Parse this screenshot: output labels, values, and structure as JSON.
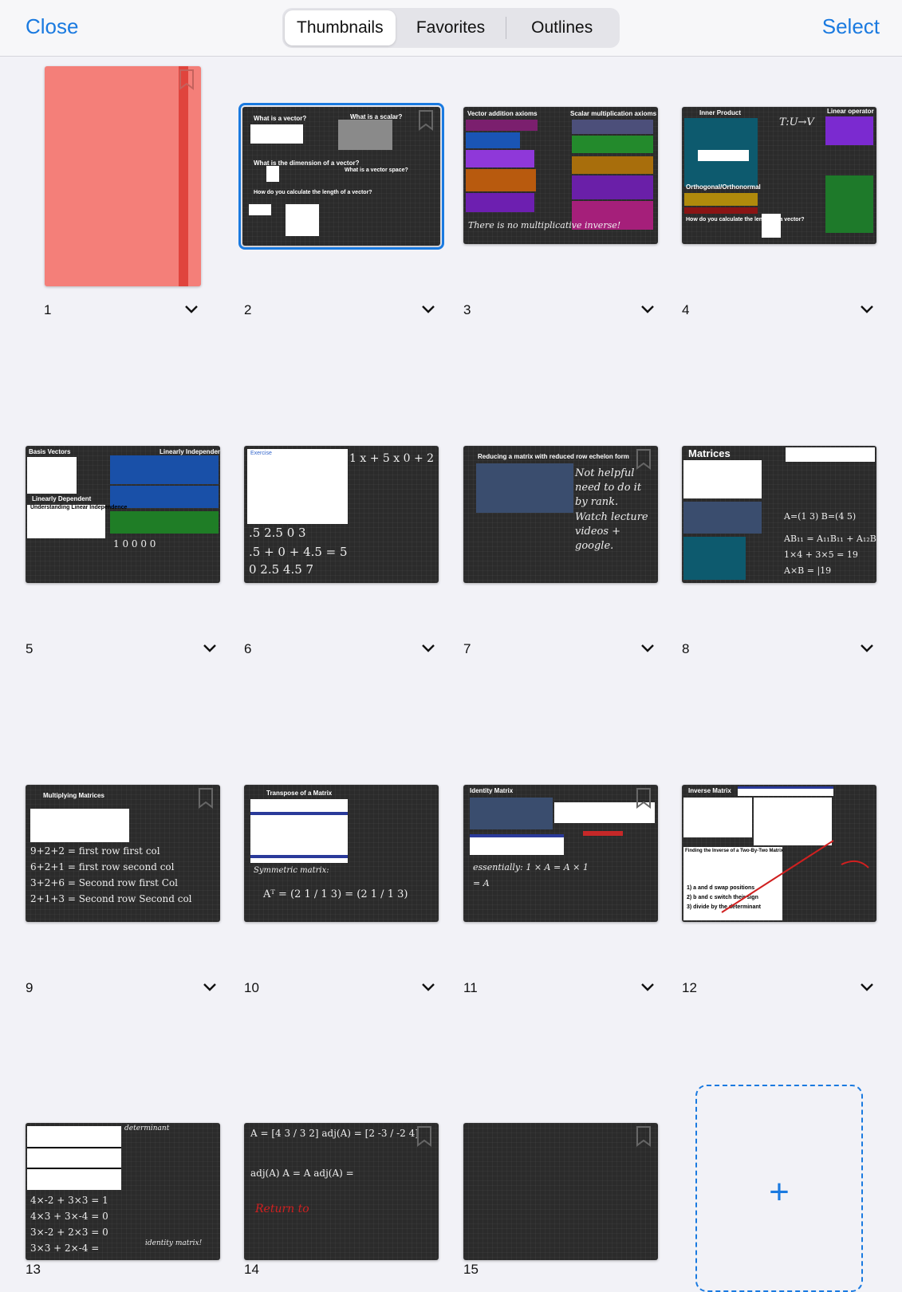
{
  "toolbar": {
    "close_label": "Close",
    "select_label": "Select",
    "tabs": [
      "Thumbnails",
      "Favorites",
      "Outlines"
    ],
    "active_tab": "Thumbnails"
  },
  "pages": [
    {
      "number": "1"
    },
    {
      "number": "2",
      "title_a": "What is a vector?",
      "title_b": "What is a scalar?",
      "title_c": "What is the dimension of a vector?",
      "title_d": "How do you calculate the length of a vector?",
      "title_e": "What is a vector space?"
    },
    {
      "number": "3",
      "title_a": "Vector addition axioms",
      "title_b": "Scalar multiplication axioms",
      "note": "There is no multiplicative inverse!"
    },
    {
      "number": "4",
      "title_a": "Inner Product",
      "title_b": "Linear operator",
      "title_c": "Orthogonal/Orthonormal",
      "title_d": "How do you calculate the length of a vector?",
      "note": "T:U→V"
    },
    {
      "number": "5",
      "title_a": "Basis Vectors",
      "title_b": "Linearly Independent",
      "title_c": "Linearly Dependent",
      "title_d": "Understanding Linear Independence"
    },
    {
      "number": "6",
      "title_a": "Exercise"
    },
    {
      "number": "7",
      "title_a": "Reducing a matrix with reduced row echelon form",
      "note": "Not helpful need to do it by rank. Watch lecture videos + google."
    },
    {
      "number": "8",
      "title_a": "Matrices",
      "note": "A=(1 3) B=(4 5)"
    },
    {
      "number": "9",
      "title_a": "Multiplying Matrices",
      "lines": [
        "9+2+2 = first row first col",
        "6+2+1 = first row second col",
        "3+2+6 = Second row first Col",
        "2+1+3 = Second row Second col"
      ]
    },
    {
      "number": "10",
      "title_a": "Transpose of a Matrix",
      "note": "Symmetric matrix:"
    },
    {
      "number": "11",
      "title_a": "Identity Matrix",
      "note": "essentially: 1 × A = A × 1 = A"
    },
    {
      "number": "12",
      "title_a": "Inverse Matrix",
      "title_b": "Finding the Inverse of a Two-By-Two Matrix",
      "steps": [
        "1) a and d swap positions",
        "2) b and c switch their sign",
        "3) divide by the determinant"
      ]
    },
    {
      "number": "13",
      "note": "determinant",
      "note_b": "identity matrix!"
    },
    {
      "number": "14"
    },
    {
      "number": "15"
    }
  ],
  "add_page": {
    "icon": "plus-icon",
    "label": "+"
  },
  "colors": {
    "accent": "#1a7ae0",
    "cover": "#f47f79",
    "cover_band": "#e0443d",
    "page_bg": "#2b2b2b"
  }
}
